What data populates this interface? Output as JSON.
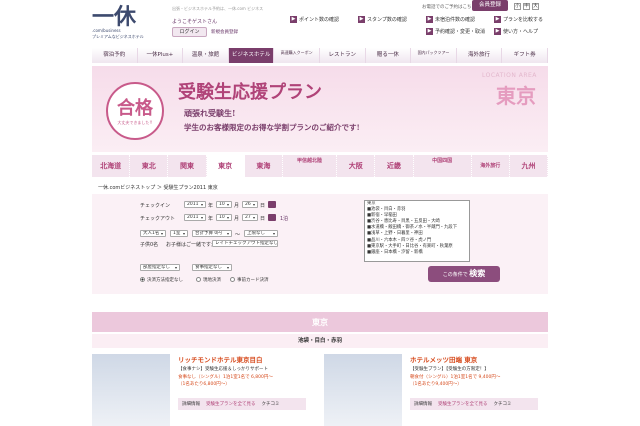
{
  "header": {
    "logo_main": "一休",
    "logo_sub1": ".com/business",
    "logo_sub2": "プレミアムなビジネスホテル",
    "tagline": "出張・ビジネスホテル予約は、一休.com ビジネス",
    "welcome": "ようこそゲストさん",
    "login": "ログイン",
    "new_register": "新規会員登録",
    "links": [
      "ポイント数の確認",
      "スタンプ数の確認",
      "未宿泊件数の確認",
      "プランを比較する",
      "予約確認・変更・取消",
      "使い方・ヘルプ"
    ],
    "tel": "お電話でのご予約はこちら",
    "member_register": "会員登録",
    "font_sizes": [
      "小",
      "中",
      "大"
    ]
  },
  "nav": [
    "宿泊予約",
    "一休Plus+",
    "温泉・旅館",
    "ビジネスホテル",
    "高速購入クーポン",
    "レストラン",
    "贈る一休",
    "国内パックツアー",
    "海外旅行",
    "ギフト券"
  ],
  "nav_active": 3,
  "banner": {
    "stamp_big": "合格",
    "stamp_small": "大丈夫できました!!",
    "title": "受験生応援プラン",
    "sub1": "頑張れ受験生!",
    "sub2": "学生のお客様限定のお得な学割プランのご紹介です!",
    "location_area": "LOCATION AREA",
    "city": "東京"
  },
  "regions": [
    "北海道",
    "東北",
    "関東",
    "東京",
    "東海",
    "甲信越北陸",
    "大阪",
    "近畿",
    "中国四国",
    "海外旅行",
    "九州"
  ],
  "region_active": 3,
  "breadcrumb": "一休.comビジネストップ ＞ 受験生プラン2011 東京",
  "search": {
    "checkin_label": "チェックイン",
    "checkout_label": "チェックアウト",
    "ci_year": "2011",
    "ci_month": "10",
    "ci_day": "26",
    "co_year": "2011",
    "co_month": "10",
    "co_day": "27",
    "year_unit": "年",
    "month_unit": "月",
    "day_unit": "日",
    "nights": "1泊",
    "adults": "大人1名",
    "rooms": "1室",
    "budget": "合計予算 0円",
    "tilde": "〜",
    "budget_max": "上限なし",
    "child_label": "子供0名",
    "child_link": "お子様はご一緒ですか？",
    "layout": "部屋指定なし",
    "checkout_time": "レイトチェックアウト指定なし",
    "room_type": "部屋指定なし",
    "meal": "食事指定なし",
    "payment": [
      "決済方法指定なし",
      "現地決済",
      "事前カード決済"
    ],
    "area_list": [
      "東京",
      "■池袋・目白・赤羽",
      "■新宿・早稲田",
      "■渋谷・恵比寿・目黒・五反田・大崎",
      "■水道橋・飯田橋・御茶ノ水・半蔵門・九段下",
      "■浅草・上野・日暮里・神田",
      "■品川・六本木・四ツ谷・虎ノ門",
      "■東京駅・大手町・日比谷・有楽町・秋葉原",
      "■銀座・日本橋・汐留・新橋"
    ],
    "search_btn_small": "この条件で",
    "search_btn_big": "検索"
  },
  "results": {
    "area": "東京",
    "subarea": "池袋・目白・赤羽",
    "hotels": [
      {
        "name": "リッチモンドホテル東京目白",
        "tag": "【食事ナシ】受験生応援＆しっかりサポート",
        "price_line1": "食事なし（シングル）1泊1室1名で 6,800円〜",
        "price_line2": "（1名あたり6,800円〜）",
        "buttons": [
          "詳細情報",
          "受験生プランを全て見る",
          "クチコミ"
        ]
      },
      {
        "name": "ホテルメッツ田端 東京",
        "tag": "【受験生プラン】【受験生の方限定！】",
        "price_line1": "朝食付（シングル）1泊1室1名で 9,400円〜",
        "price_line2": "（1名あたり9,400円〜）",
        "buttons": [
          "詳細情報",
          "受験生プランを全て見る",
          "クチコミ"
        ]
      }
    ]
  }
}
